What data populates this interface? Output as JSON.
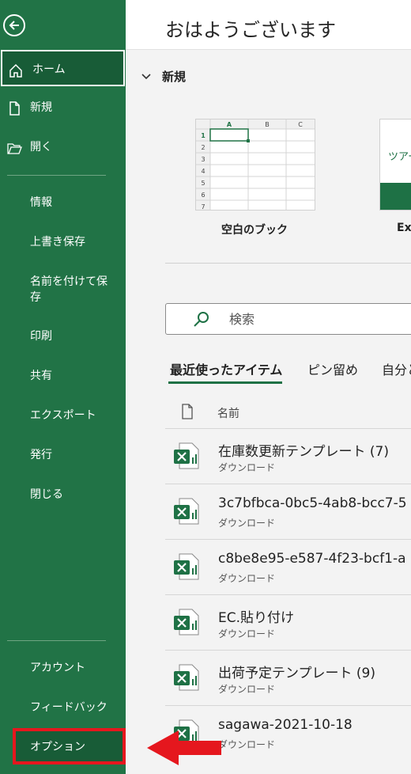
{
  "sidebar": {
    "items": [
      {
        "label": "ホーム",
        "icon": "home-icon"
      },
      {
        "label": "新規",
        "icon": "new-document-icon"
      },
      {
        "label": "開く",
        "icon": "open-folder-icon"
      },
      {
        "label": "情報"
      },
      {
        "label": "上書き保存"
      },
      {
        "label": "名前を付けて保\n存"
      },
      {
        "label": "印刷"
      },
      {
        "label": "共有"
      },
      {
        "label": "エクスポート"
      },
      {
        "label": "発行"
      },
      {
        "label": "閉じる"
      },
      {
        "label": "アカウント"
      },
      {
        "label": "フィードバック"
      },
      {
        "label": "オプション"
      }
    ]
  },
  "main": {
    "greeting": "おはようございます",
    "new_section": "新規",
    "templates": [
      {
        "label": "空白のブック",
        "columns": [
          "A",
          "B",
          "C"
        ],
        "rows": [
          "1",
          "2",
          "3",
          "4",
          "5",
          "6",
          "7"
        ]
      },
      {
        "label": "Ex",
        "thumb_text": "ツアー"
      }
    ],
    "search_placeholder": "検索",
    "tabs": [
      "最近使ったアイテム",
      "ピン留め",
      "自分と"
    ],
    "list_header": "名前",
    "files": [
      {
        "name": "在庫数更新テンプレート (7)",
        "location": "ダウンロード"
      },
      {
        "name": "3c7bfbca-0bc5-4ab8-bcc7-5",
        "location": "ダウンロード"
      },
      {
        "name": "c8be8e95-e587-4f23-bcf1-a",
        "location": "ダウンロード"
      },
      {
        "name": "EC.貼り付け",
        "location": "ダウンロード"
      },
      {
        "name": "出荷予定テンプレート (9)",
        "location": "ダウンロード"
      },
      {
        "name": "sagawa-2021-10-18",
        "location": "ダウンロード"
      }
    ]
  },
  "colors": {
    "sidebar": "#217346",
    "active": "#185c37",
    "highlight": "#e5171e",
    "accent": "#1e7145"
  }
}
